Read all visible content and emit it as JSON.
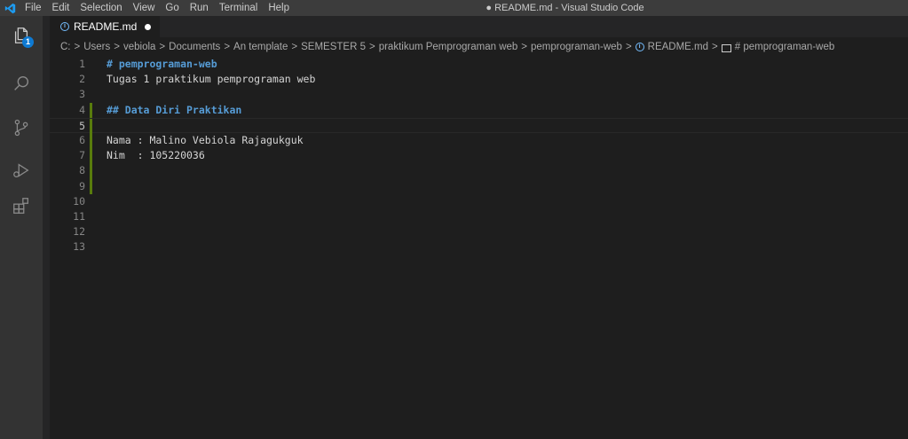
{
  "titlebar": {
    "menu": [
      "File",
      "Edit",
      "Selection",
      "View",
      "Go",
      "Run",
      "Terminal",
      "Help"
    ],
    "window_title": "● README.md - Visual Studio Code"
  },
  "activitybar": {
    "items": [
      "explorer-icon",
      "search-icon",
      "source-control-icon",
      "run-debug-icon",
      "extensions-icon"
    ],
    "explorer_badge": "1"
  },
  "tab": {
    "label": "README.md",
    "dirty": true
  },
  "breadcrumb": {
    "items": [
      "C:",
      "Users",
      "vebiola",
      "Documents",
      "An template",
      "SEMESTER 5",
      "praktikum Pemprograman web",
      "pemprograman-web",
      "README.md",
      "# pemprograman-web"
    ],
    "separator": ">"
  },
  "editor": {
    "current_line": 5,
    "modified_lines": [
      4,
      5,
      6,
      7,
      8,
      9
    ],
    "lines": [
      {
        "number": "1",
        "text": "# pemprograman-web",
        "type": "heading"
      },
      {
        "number": "2",
        "text": "Tugas 1 praktikum pemprograman web",
        "type": "text"
      },
      {
        "number": "3",
        "text": "",
        "type": "text"
      },
      {
        "number": "4",
        "text": "## Data Diri Praktikan",
        "type": "heading"
      },
      {
        "number": "5",
        "text": "",
        "type": "text"
      },
      {
        "number": "6",
        "text": "Nama : Malino Vebiola Rajagukguk",
        "type": "text"
      },
      {
        "number": "7",
        "text": "Nim  : 105220036",
        "type": "text"
      },
      {
        "number": "8",
        "text": "",
        "type": "text"
      },
      {
        "number": "9",
        "text": "",
        "type": "text"
      },
      {
        "number": "10",
        "text": "",
        "type": "text"
      },
      {
        "number": "11",
        "text": "",
        "type": "text"
      },
      {
        "number": "12",
        "text": "",
        "type": "text"
      },
      {
        "number": "13",
        "text": "",
        "type": "text"
      }
    ]
  },
  "colors": {
    "accent": "#0e7ad3",
    "heading": "#569cd6",
    "modified_gutter": "#587c0c"
  }
}
